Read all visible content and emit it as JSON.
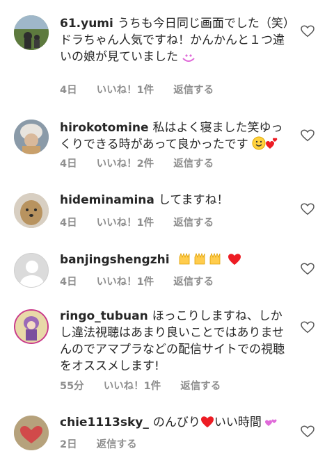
{
  "comments": [
    {
      "username": "61.yumi",
      "text": "うちも今日同じ画面でした（笑）ドラちゃん人気ですね！かんかんと１つ違いの娘が見ていました",
      "time": "4日",
      "likes": "いいね！1件",
      "reply": "返信する",
      "emoji": "heart-eyes"
    },
    {
      "username": "hirokotomine",
      "text": "私はよく寝ました笑ゆっくりできる時があって良かったです",
      "time": "4日",
      "likes": "いいね！2件",
      "reply": "返信する",
      "emoji": "smile-hearts"
    },
    {
      "username": "hideminamina",
      "text": "してますね！",
      "time": "4日",
      "likes": "いいね！1件",
      "reply": "返信する"
    },
    {
      "username": "banjingshengzhi",
      "text": "",
      "time": "4日",
      "likes": "いいね！1件",
      "reply": "返信する",
      "emoji": "raised-hands-x3-heart"
    },
    {
      "username": "ringo_tubuan",
      "text": "ほっこりしますね、しかし違法視聴はあまり良いことではありませんのでアマプラなどの配信サイトでの視聴をオススメします!",
      "time": "55分",
      "likes": "いいね！1件",
      "reply": "返信する"
    },
    {
      "username": "chie1113sky_",
      "text_before": "のんびり",
      "text_after": "いい時間",
      "time": "2日",
      "reply": "返信する"
    }
  ],
  "colors": {
    "text": "#262626",
    "meta": "#8e8e8e",
    "heart_red": "#ed1c24",
    "emoji_pink": "#e06ad9"
  }
}
